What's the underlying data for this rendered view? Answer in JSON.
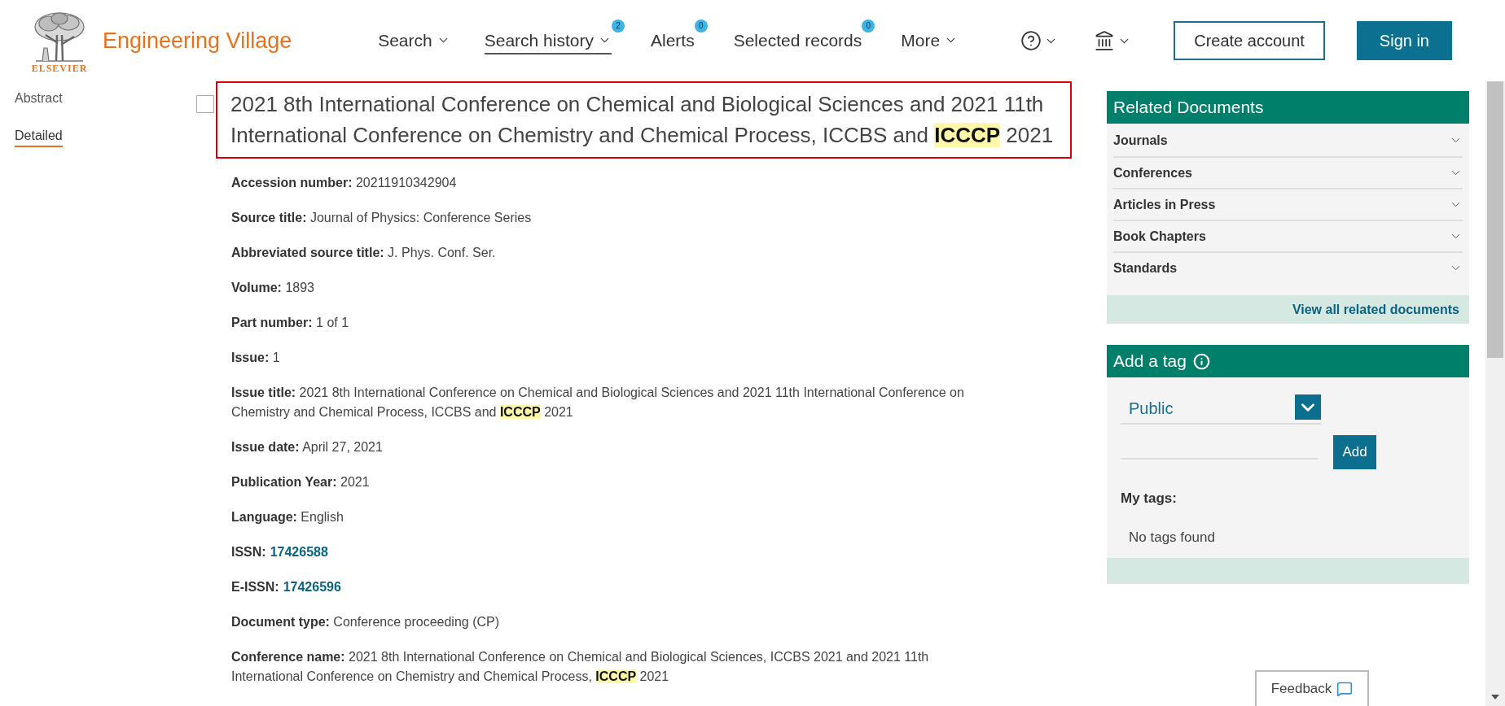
{
  "header": {
    "logo_text": "ELSEVIER",
    "brand": "Engineering Village",
    "nav": [
      {
        "label": "Search",
        "dropdown": true,
        "selected": false
      },
      {
        "label": "Search history",
        "dropdown": true,
        "selected": true,
        "badge": "2"
      },
      {
        "label": "Alerts",
        "dropdown": false,
        "selected": false,
        "badge": "0"
      },
      {
        "label": "Selected records",
        "dropdown": false,
        "selected": false,
        "badge": "0"
      },
      {
        "label": "More",
        "dropdown": true,
        "selected": false
      }
    ],
    "buttons": [
      {
        "label": "Create account",
        "kind": "outline"
      },
      {
        "label": "Sign in",
        "kind": "primary"
      }
    ]
  },
  "view_tabs": [
    {
      "label": "Abstract",
      "selected": false
    },
    {
      "label": "Detailed",
      "selected": true
    }
  ],
  "record": {
    "checked": false,
    "title": "2021 8th International Conference on Chemical and Biological Sciences and 2021 11th International Conference on Chemistry and Chemical Process, ICCBS and **ICCCP** 2021",
    "fields": [
      {
        "label": "Accession number:",
        "value": "20211910342904",
        "kind": "text"
      },
      {
        "label": "Source title:",
        "value": "Journal of Physics: Conference Series",
        "kind": "text"
      },
      {
        "label": "Abbreviated source title:",
        "value": "J. Phys. Conf. Ser.",
        "kind": "text"
      },
      {
        "label": "Volume:",
        "value": "1893",
        "kind": "text"
      },
      {
        "label": "Part number:",
        "value": "1 of 1",
        "kind": "text"
      },
      {
        "label": "Issue:",
        "value": "1",
        "kind": "text"
      },
      {
        "label": "Issue title:",
        "value": "2021 8th International Conference on Chemical and Biological Sciences and 2021 11th International Conference on Chemistry and Chemical Process, ICCBS and **ICCCP** 2021",
        "kind": "text"
      },
      {
        "label": "Issue date:",
        "value": "April 27, 2021",
        "kind": "text"
      },
      {
        "label": "Publication Year:",
        "value": "2021",
        "kind": "text"
      },
      {
        "label": "Language:",
        "value": "English",
        "kind": "text"
      },
      {
        "label": "ISSN:",
        "value": "17426588",
        "kind": "link"
      },
      {
        "label": "E-ISSN:",
        "value": "17426596",
        "kind": "link"
      },
      {
        "label": "Document type:",
        "value": "Conference proceeding (CP)",
        "kind": "text"
      },
      {
        "label": "Conference name:",
        "value": "2021 8th International Conference on Chemical and Biological Sciences, ICCBS 2021 and 2021 11th International Conference on Chemistry and Chemical Process, **ICCCP** 2021",
        "kind": "text"
      }
    ]
  },
  "related_documents": {
    "title": "Related Documents",
    "items": [
      {
        "label": "Journals",
        "expanded": false
      },
      {
        "label": "Conferences",
        "expanded": false
      },
      {
        "label": "Articles in Press",
        "expanded": false
      },
      {
        "label": "Book Chapters",
        "expanded": false
      },
      {
        "label": "Standards",
        "expanded": false
      }
    ],
    "view_all": "View all related documents"
  },
  "add_tag": {
    "title": "Add a tag",
    "visibility": "Public",
    "button": "Add",
    "my_tags_label": "My tags:",
    "empty_message": "No tags found"
  },
  "feedback": "Feedback"
}
